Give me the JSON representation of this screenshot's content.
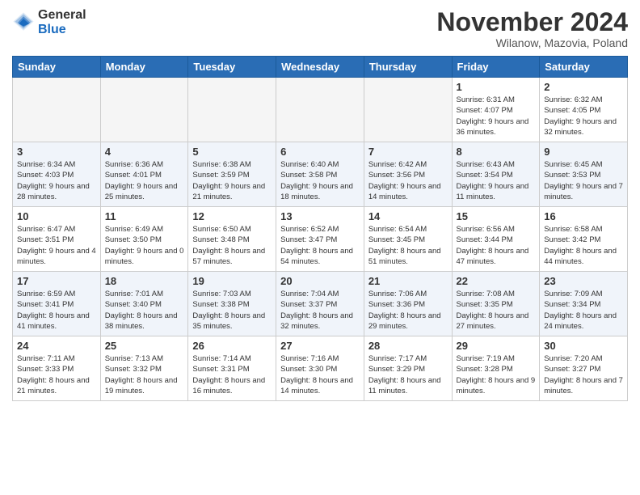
{
  "header": {
    "logo_general": "General",
    "logo_blue": "Blue",
    "month_title": "November 2024",
    "location": "Wilanow, Mazovia, Poland"
  },
  "days_of_week": [
    "Sunday",
    "Monday",
    "Tuesday",
    "Wednesday",
    "Thursday",
    "Friday",
    "Saturday"
  ],
  "weeks": [
    [
      {
        "day": "",
        "empty": true
      },
      {
        "day": "",
        "empty": true
      },
      {
        "day": "",
        "empty": true
      },
      {
        "day": "",
        "empty": true
      },
      {
        "day": "",
        "empty": true
      },
      {
        "day": "1",
        "sunrise": "Sunrise: 6:31 AM",
        "sunset": "Sunset: 4:07 PM",
        "daylight": "Daylight: 9 hours and 36 minutes."
      },
      {
        "day": "2",
        "sunrise": "Sunrise: 6:32 AM",
        "sunset": "Sunset: 4:05 PM",
        "daylight": "Daylight: 9 hours and 32 minutes."
      }
    ],
    [
      {
        "day": "3",
        "sunrise": "Sunrise: 6:34 AM",
        "sunset": "Sunset: 4:03 PM",
        "daylight": "Daylight: 9 hours and 28 minutes."
      },
      {
        "day": "4",
        "sunrise": "Sunrise: 6:36 AM",
        "sunset": "Sunset: 4:01 PM",
        "daylight": "Daylight: 9 hours and 25 minutes."
      },
      {
        "day": "5",
        "sunrise": "Sunrise: 6:38 AM",
        "sunset": "Sunset: 3:59 PM",
        "daylight": "Daylight: 9 hours and 21 minutes."
      },
      {
        "day": "6",
        "sunrise": "Sunrise: 6:40 AM",
        "sunset": "Sunset: 3:58 PM",
        "daylight": "Daylight: 9 hours and 18 minutes."
      },
      {
        "day": "7",
        "sunrise": "Sunrise: 6:42 AM",
        "sunset": "Sunset: 3:56 PM",
        "daylight": "Daylight: 9 hours and 14 minutes."
      },
      {
        "day": "8",
        "sunrise": "Sunrise: 6:43 AM",
        "sunset": "Sunset: 3:54 PM",
        "daylight": "Daylight: 9 hours and 11 minutes."
      },
      {
        "day": "9",
        "sunrise": "Sunrise: 6:45 AM",
        "sunset": "Sunset: 3:53 PM",
        "daylight": "Daylight: 9 hours and 7 minutes."
      }
    ],
    [
      {
        "day": "10",
        "sunrise": "Sunrise: 6:47 AM",
        "sunset": "Sunset: 3:51 PM",
        "daylight": "Daylight: 9 hours and 4 minutes."
      },
      {
        "day": "11",
        "sunrise": "Sunrise: 6:49 AM",
        "sunset": "Sunset: 3:50 PM",
        "daylight": "Daylight: 9 hours and 0 minutes."
      },
      {
        "day": "12",
        "sunrise": "Sunrise: 6:50 AM",
        "sunset": "Sunset: 3:48 PM",
        "daylight": "Daylight: 8 hours and 57 minutes."
      },
      {
        "day": "13",
        "sunrise": "Sunrise: 6:52 AM",
        "sunset": "Sunset: 3:47 PM",
        "daylight": "Daylight: 8 hours and 54 minutes."
      },
      {
        "day": "14",
        "sunrise": "Sunrise: 6:54 AM",
        "sunset": "Sunset: 3:45 PM",
        "daylight": "Daylight: 8 hours and 51 minutes."
      },
      {
        "day": "15",
        "sunrise": "Sunrise: 6:56 AM",
        "sunset": "Sunset: 3:44 PM",
        "daylight": "Daylight: 8 hours and 47 minutes."
      },
      {
        "day": "16",
        "sunrise": "Sunrise: 6:58 AM",
        "sunset": "Sunset: 3:42 PM",
        "daylight": "Daylight: 8 hours and 44 minutes."
      }
    ],
    [
      {
        "day": "17",
        "sunrise": "Sunrise: 6:59 AM",
        "sunset": "Sunset: 3:41 PM",
        "daylight": "Daylight: 8 hours and 41 minutes."
      },
      {
        "day": "18",
        "sunrise": "Sunrise: 7:01 AM",
        "sunset": "Sunset: 3:40 PM",
        "daylight": "Daylight: 8 hours and 38 minutes."
      },
      {
        "day": "19",
        "sunrise": "Sunrise: 7:03 AM",
        "sunset": "Sunset: 3:38 PM",
        "daylight": "Daylight: 8 hours and 35 minutes."
      },
      {
        "day": "20",
        "sunrise": "Sunrise: 7:04 AM",
        "sunset": "Sunset: 3:37 PM",
        "daylight": "Daylight: 8 hours and 32 minutes."
      },
      {
        "day": "21",
        "sunrise": "Sunrise: 7:06 AM",
        "sunset": "Sunset: 3:36 PM",
        "daylight": "Daylight: 8 hours and 29 minutes."
      },
      {
        "day": "22",
        "sunrise": "Sunrise: 7:08 AM",
        "sunset": "Sunset: 3:35 PM",
        "daylight": "Daylight: 8 hours and 27 minutes."
      },
      {
        "day": "23",
        "sunrise": "Sunrise: 7:09 AM",
        "sunset": "Sunset: 3:34 PM",
        "daylight": "Daylight: 8 hours and 24 minutes."
      }
    ],
    [
      {
        "day": "24",
        "sunrise": "Sunrise: 7:11 AM",
        "sunset": "Sunset: 3:33 PM",
        "daylight": "Daylight: 8 hours and 21 minutes."
      },
      {
        "day": "25",
        "sunrise": "Sunrise: 7:13 AM",
        "sunset": "Sunset: 3:32 PM",
        "daylight": "Daylight: 8 hours and 19 minutes."
      },
      {
        "day": "26",
        "sunrise": "Sunrise: 7:14 AM",
        "sunset": "Sunset: 3:31 PM",
        "daylight": "Daylight: 8 hours and 16 minutes."
      },
      {
        "day": "27",
        "sunrise": "Sunrise: 7:16 AM",
        "sunset": "Sunset: 3:30 PM",
        "daylight": "Daylight: 8 hours and 14 minutes."
      },
      {
        "day": "28",
        "sunrise": "Sunrise: 7:17 AM",
        "sunset": "Sunset: 3:29 PM",
        "daylight": "Daylight: 8 hours and 11 minutes."
      },
      {
        "day": "29",
        "sunrise": "Sunrise: 7:19 AM",
        "sunset": "Sunset: 3:28 PM",
        "daylight": "Daylight: 8 hours and 9 minutes."
      },
      {
        "day": "30",
        "sunrise": "Sunrise: 7:20 AM",
        "sunset": "Sunset: 3:27 PM",
        "daylight": "Daylight: 8 hours and 7 minutes."
      }
    ]
  ]
}
